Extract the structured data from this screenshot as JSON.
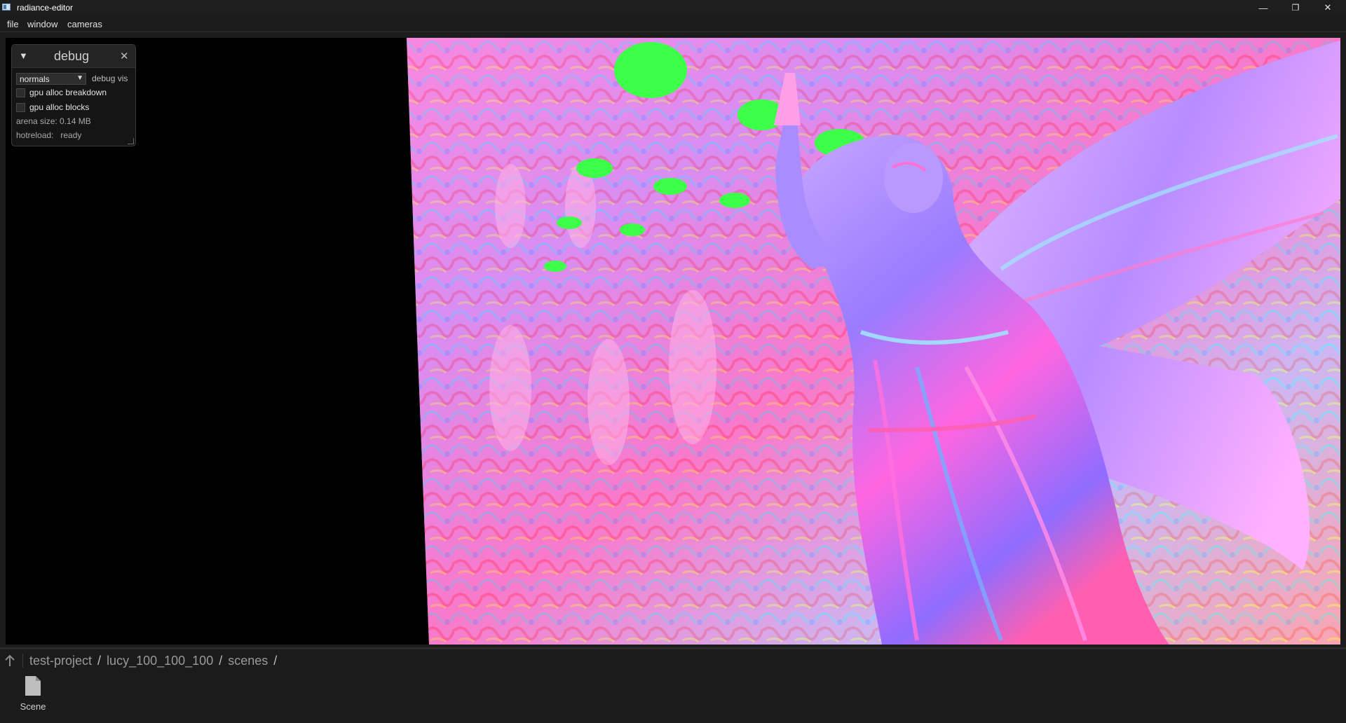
{
  "window": {
    "title": "radiance-editor",
    "controls": {
      "minimize": "—",
      "restore": "❐",
      "close": "✕"
    }
  },
  "menubar": {
    "items": [
      {
        "label": "file"
      },
      {
        "label": "window"
      },
      {
        "label": "cameras"
      }
    ]
  },
  "viewport": {
    "scene": "lucy_100_100_100",
    "render_mode": "normals",
    "background_color": "#000000"
  },
  "debug_panel": {
    "title": "debug",
    "collapse_icon": "▼",
    "close_icon": "✕",
    "select": {
      "value": "normals",
      "label": "debug vis"
    },
    "checkboxes": [
      {
        "label": "gpu alloc breakdown",
        "checked": false
      },
      {
        "label": "gpu alloc blocks",
        "checked": false
      }
    ],
    "arena_size": "arena size: 0.14 MB",
    "hotreload": "hotreload:   ready"
  },
  "file_browser": {
    "breadcrumb": [
      "test-project",
      "lucy_100_100_100",
      "scenes"
    ],
    "separator": "/",
    "items": [
      {
        "name": "Scene",
        "icon": "file-icon"
      }
    ]
  },
  "colors": {
    "background": "#1c1c1c",
    "panel": "#151515",
    "viewport": "#000000"
  }
}
